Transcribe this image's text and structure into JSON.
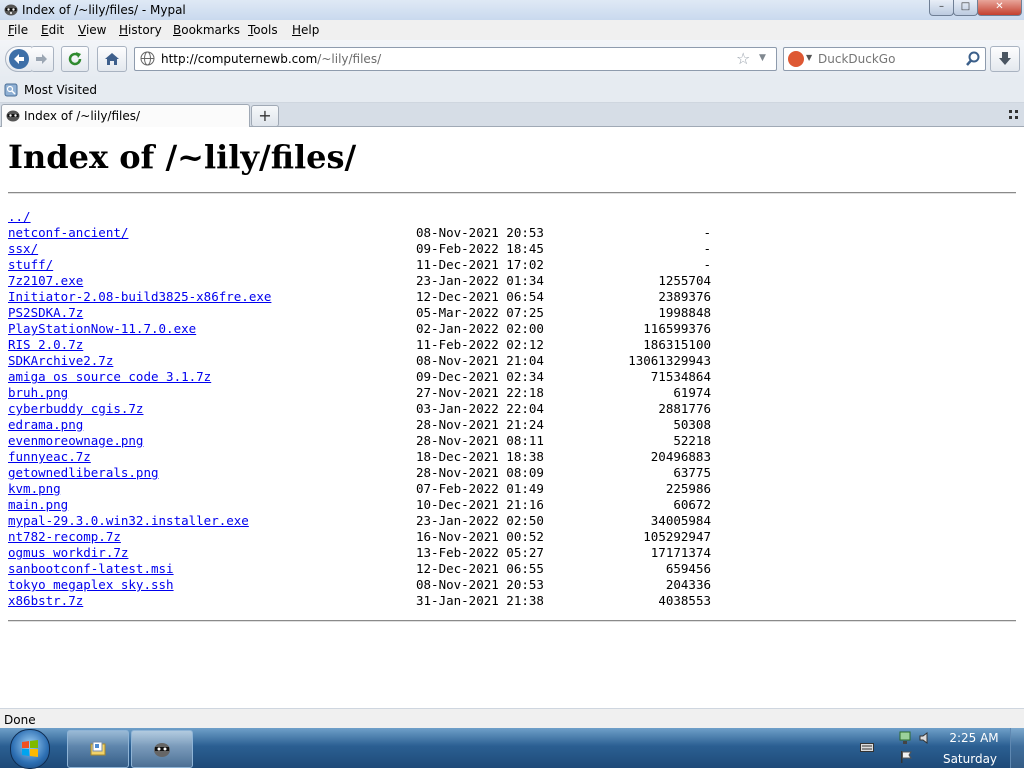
{
  "window": {
    "title": "Index of /~lily/files/ - Mypal",
    "controls": {
      "minimize": "–",
      "maximize": "□",
      "close": "✕"
    }
  },
  "menu": {
    "items": [
      {
        "label": "File",
        "accel": "F",
        "rest": "ile"
      },
      {
        "label": "Edit",
        "accel": "E",
        "rest": "dit"
      },
      {
        "label": "View",
        "accel": "V",
        "rest": "iew"
      },
      {
        "label": "History",
        "accel": "H",
        "rest": "istory"
      },
      {
        "label": "Bookmarks",
        "accel": "B",
        "rest": "ookmarks"
      },
      {
        "label": "Tools",
        "accel": "T",
        "rest": "ools"
      },
      {
        "label": "Help",
        "accel": "H",
        "rest": "elp"
      }
    ]
  },
  "navbar": {
    "url_host": "http://computernewb.com",
    "url_path": "/~lily/files/",
    "search_placeholder": "DuckDuckGo"
  },
  "bookmarks": {
    "most_visited": "Most Visited"
  },
  "tabs": [
    {
      "label": "Index of /~lily/files/"
    }
  ],
  "page": {
    "heading": "Index of /~lily/files/",
    "entries": [
      {
        "name": "../",
        "date": "",
        "size": ""
      },
      {
        "name": "netconf-ancient/",
        "date": "08-Nov-2021 20:53",
        "size": "-"
      },
      {
        "name": "ssx/",
        "date": "09-Feb-2022 18:45",
        "size": "-"
      },
      {
        "name": "stuff/",
        "date": "11-Dec-2021 17:02",
        "size": "-"
      },
      {
        "name": "7z2107.exe",
        "date": "23-Jan-2022 01:34",
        "size": "1255704"
      },
      {
        "name": "Initiator-2.08-build3825-x86fre.exe",
        "date": "12-Dec-2021 06:54",
        "size": "2389376"
      },
      {
        "name": "PS2SDKA.7z",
        "date": "05-Mar-2022 07:25",
        "size": "1998848"
      },
      {
        "name": "PlayStationNow-11.7.0.exe",
        "date": "02-Jan-2022 02:00",
        "size": "116599376"
      },
      {
        "name": "RIS 2.0.7z",
        "date": "11-Feb-2022 02:12",
        "size": "186315100"
      },
      {
        "name": "SDKArchive2.7z",
        "date": "08-Nov-2021 21:04",
        "size": "13061329943"
      },
      {
        "name": "amiga os source code 3.1.7z",
        "date": "09-Dec-2021 02:34",
        "size": "71534864"
      },
      {
        "name": "bruh.png",
        "date": "27-Nov-2021 22:18",
        "size": "61974"
      },
      {
        "name": "cyberbuddy cgis.7z",
        "date": "03-Jan-2022 22:04",
        "size": "2881776"
      },
      {
        "name": "edrama.png",
        "date": "28-Nov-2021 21:24",
        "size": "50308"
      },
      {
        "name": "evenmoreownage.png",
        "date": "28-Nov-2021 08:11",
        "size": "52218"
      },
      {
        "name": "funnyeac.7z",
        "date": "18-Dec-2021 18:38",
        "size": "20496883"
      },
      {
        "name": "getownedliberals.png",
        "date": "28-Nov-2021 08:09",
        "size": "63775"
      },
      {
        "name": "kvm.png",
        "date": "07-Feb-2022 01:49",
        "size": "225986"
      },
      {
        "name": "main.png",
        "date": "10-Dec-2021 21:16",
        "size": "60672"
      },
      {
        "name": "mypal-29.3.0.win32.installer.exe",
        "date": "23-Jan-2022 02:50",
        "size": "34005984"
      },
      {
        "name": "nt782-recomp.7z",
        "date": "16-Nov-2021 00:52",
        "size": "105292947"
      },
      {
        "name": "ogmus workdir.7z",
        "date": "13-Feb-2022 05:27",
        "size": "17171374"
      },
      {
        "name": "sanbootconf-latest.msi",
        "date": "12-Dec-2021 06:55",
        "size": "659456"
      },
      {
        "name": "tokyo megaplex sky.ssh",
        "date": "08-Nov-2021 20:53",
        "size": "204336"
      },
      {
        "name": "x86bstr.7z",
        "date": "31-Jan-2021 21:38",
        "size": "4038553"
      }
    ]
  },
  "status": {
    "text": "Done"
  },
  "taskbar": {
    "clock_time": "2:25 AM",
    "clock_day": "Saturday"
  },
  "colors": {
    "link": "#0000ee",
    "taskbar": "#2b5f92"
  }
}
